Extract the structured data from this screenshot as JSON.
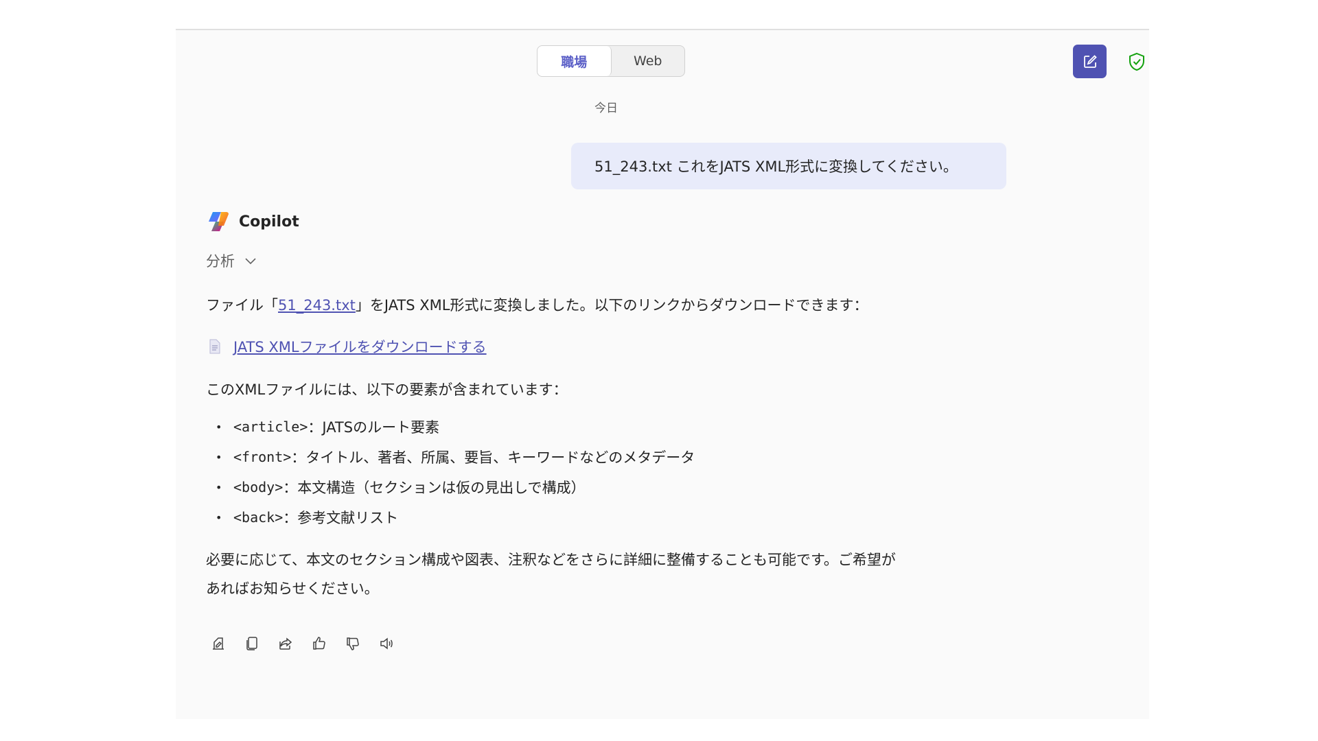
{
  "header": {
    "toggle": [
      {
        "label": "職場",
        "active": true
      },
      {
        "label": "Web",
        "active": false
      }
    ],
    "new_chat_icon": "compose-icon",
    "shield_icon": "shield-check-icon",
    "accent_color": "#4f52b2"
  },
  "conversation": {
    "date_label": "今日",
    "user_message": "51_243.txt これをJATS XML形式に変換してください。",
    "assistant": {
      "name": "Copilot",
      "analysis_label": "分析",
      "intro": {
        "prefix": "ファイル「",
        "file_link": "51_243.txt",
        "suffix": "」をJATS XML形式に変換しました。以下のリンクからダウンロードできます："
      },
      "download_link": "JATS XMLファイルをダウンロードする",
      "elements_intro": "このXMLファイルには、以下の要素が含まれています：",
      "elements": [
        {
          "tag": "<article>",
          "desc": "：JATSのルート要素"
        },
        {
          "tag": "<front>",
          "desc": "：タイトル、著者、所属、要旨、キーワードなどのメタデータ"
        },
        {
          "tag": "<body>",
          "desc": "：本文構造（セクションは仮の見出しで構成）"
        },
        {
          "tag": "<back>",
          "desc": "：参考文献リスト"
        }
      ],
      "closing_line1": "必要に応じて、本文のセクション構成や図表、注釈などをさらに詳細に整備することも可能です。ご希望が",
      "closing_line2": "あればお知らせください。"
    }
  },
  "actions": [
    "edit-in-pages-icon",
    "copy-icon",
    "share-icon",
    "thumbs-up-icon",
    "thumbs-down-icon",
    "read-aloud-icon"
  ]
}
